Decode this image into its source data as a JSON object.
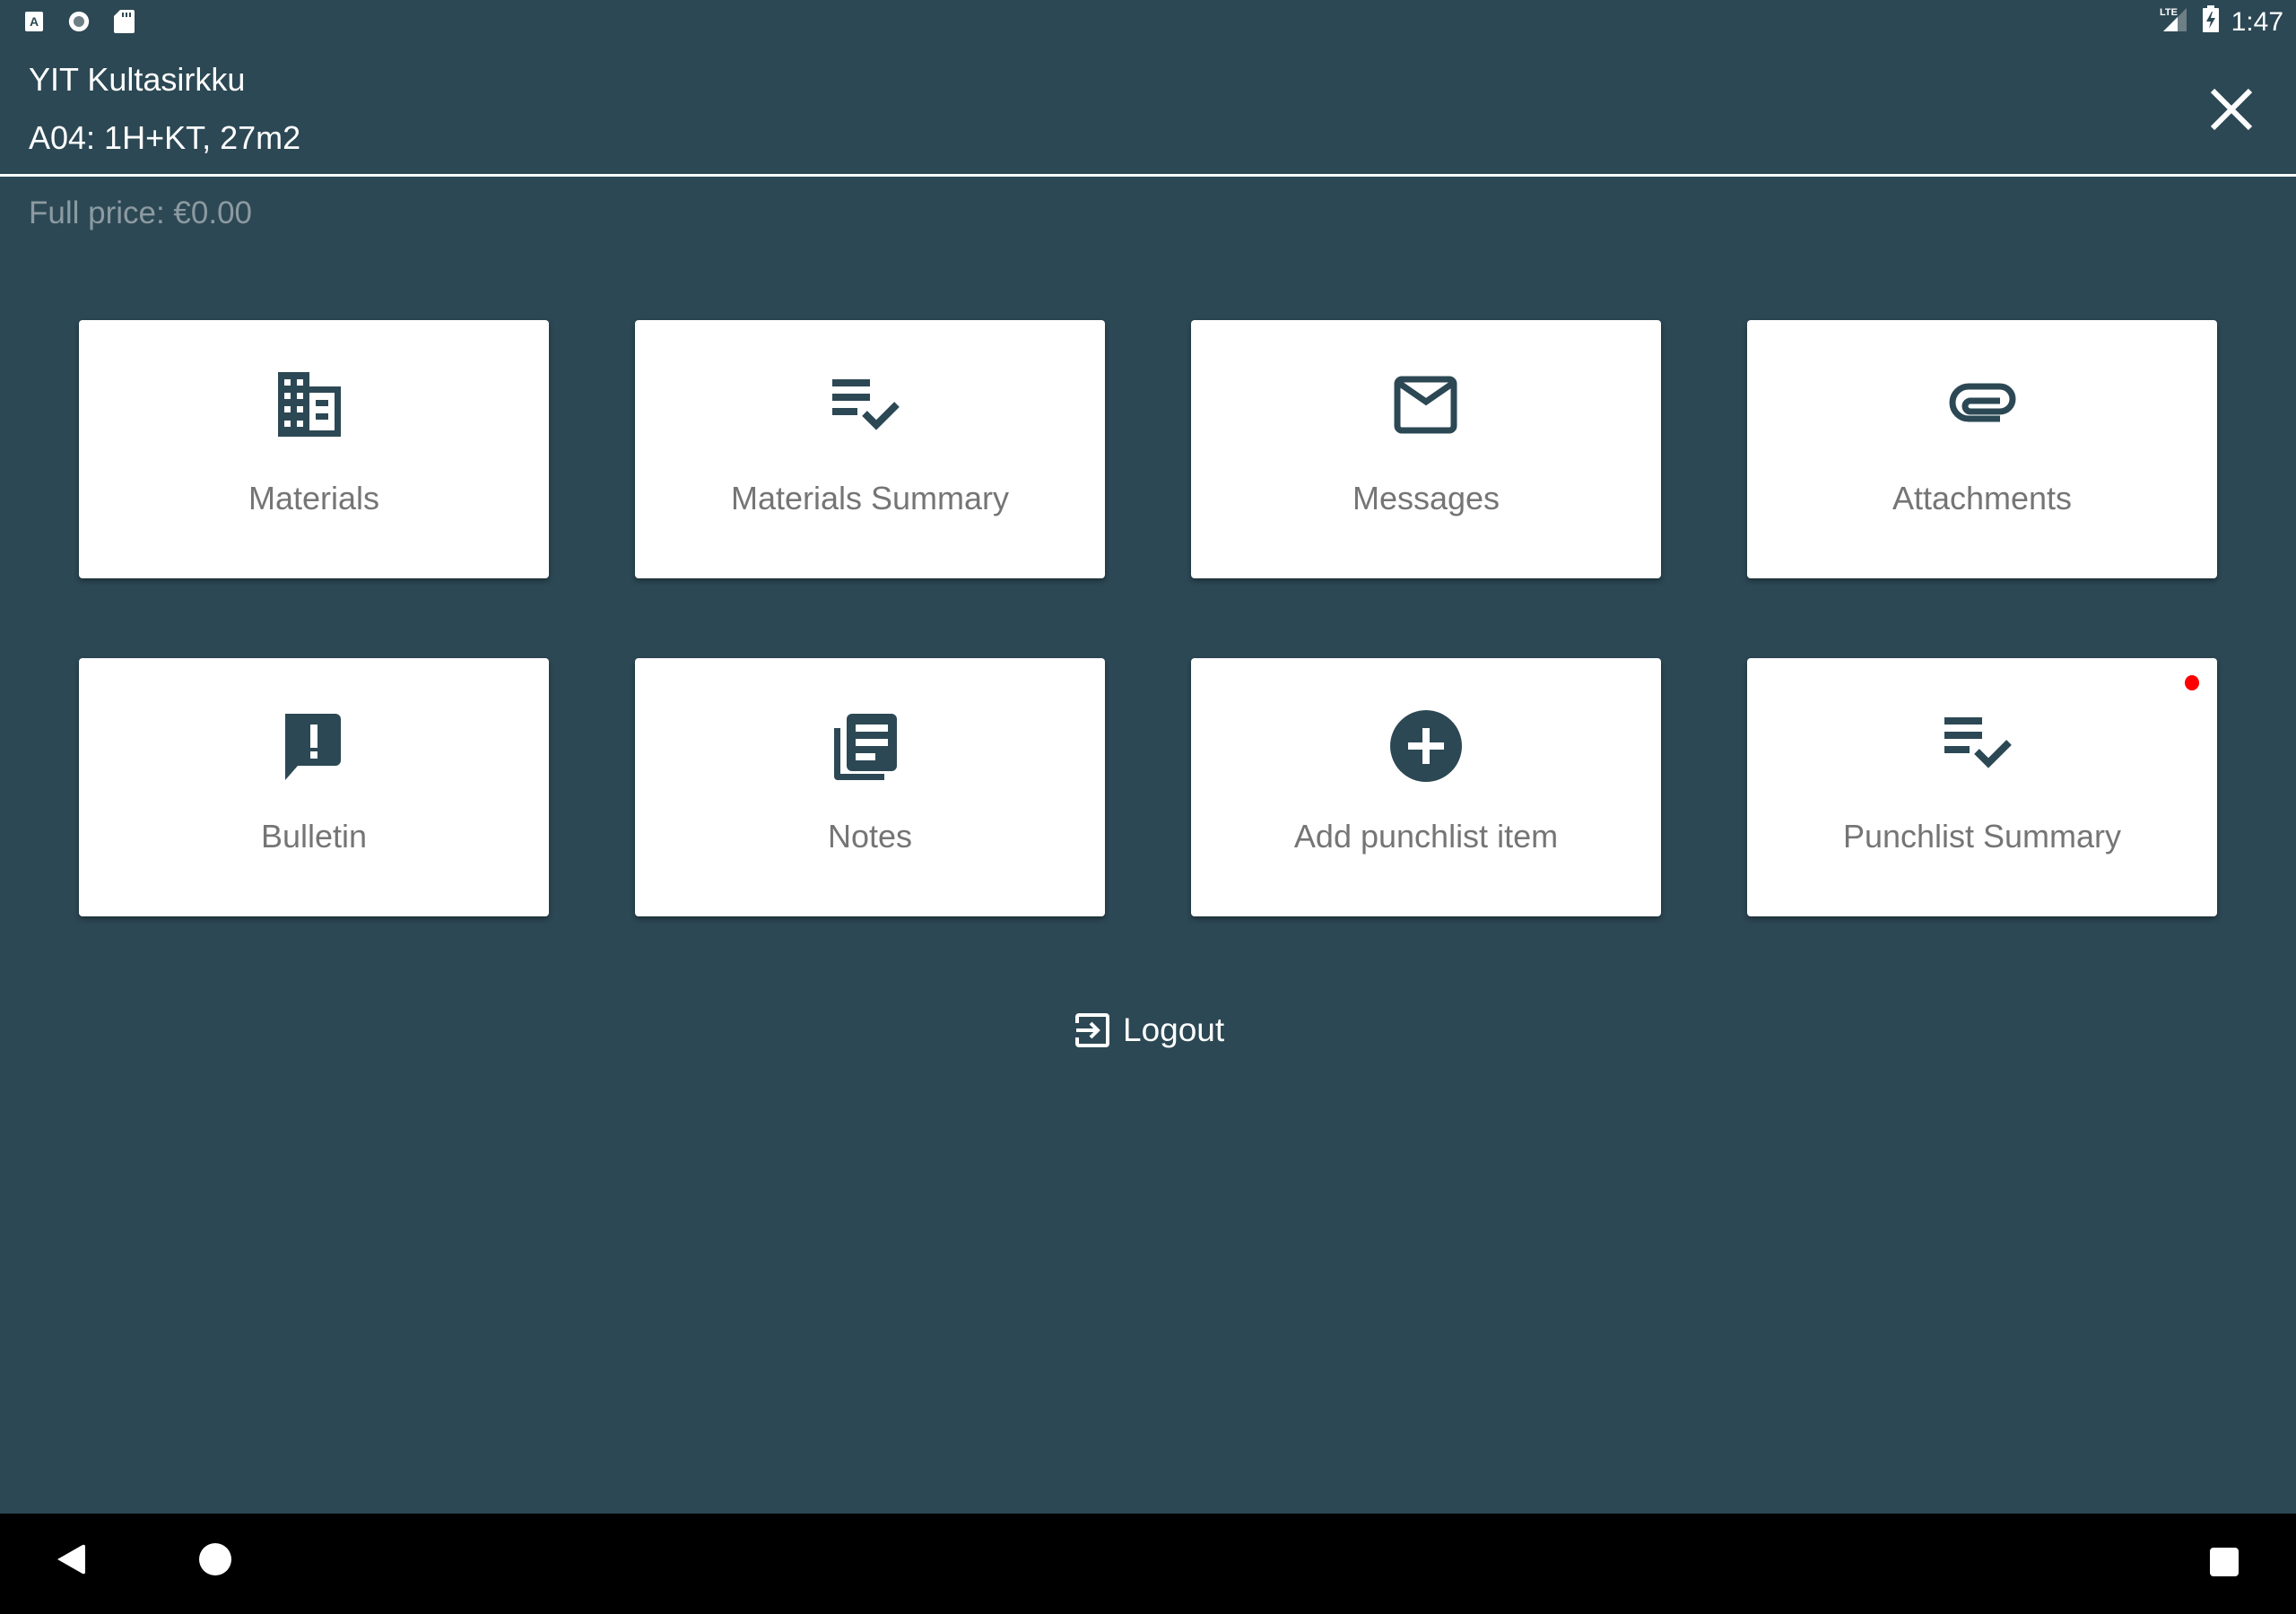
{
  "status_bar": {
    "left_icons": [
      "accessibility-a-icon",
      "record-circle-icon",
      "sd-card-icon"
    ],
    "network": "LTE",
    "time": "1:47"
  },
  "header": {
    "title": "YIT Kultasirkku",
    "subtitle": "A04: 1H+KT, 27m2",
    "close_icon": "close-icon"
  },
  "price": {
    "text": "Full price: €0.00"
  },
  "tiles": [
    {
      "label": "Materials",
      "icon": "building-icon"
    },
    {
      "label": "Materials Summary",
      "icon": "playlist-check-icon"
    },
    {
      "label": "Messages",
      "icon": "envelope-icon"
    },
    {
      "label": "Attachments",
      "icon": "paperclip-icon"
    },
    {
      "label": "Bulletin",
      "icon": "announcement-icon"
    },
    {
      "label": "Notes",
      "icon": "notes-library-icon"
    },
    {
      "label": "Add punchlist item",
      "icon": "add-circle-icon"
    },
    {
      "label": "Punchlist Summary",
      "icon": "playlist-check-icon",
      "has_notification": true
    }
  ],
  "logout": {
    "label": "Logout",
    "icon": "logout-icon"
  },
  "colors": {
    "background": "#2c4854",
    "card": "#ffffff",
    "icon": "#2c4854",
    "label": "#757575",
    "price_text": "#8c9aa1",
    "notification": "#ff0000"
  },
  "nav_bar": {
    "buttons": [
      "back",
      "home",
      "recents"
    ]
  }
}
